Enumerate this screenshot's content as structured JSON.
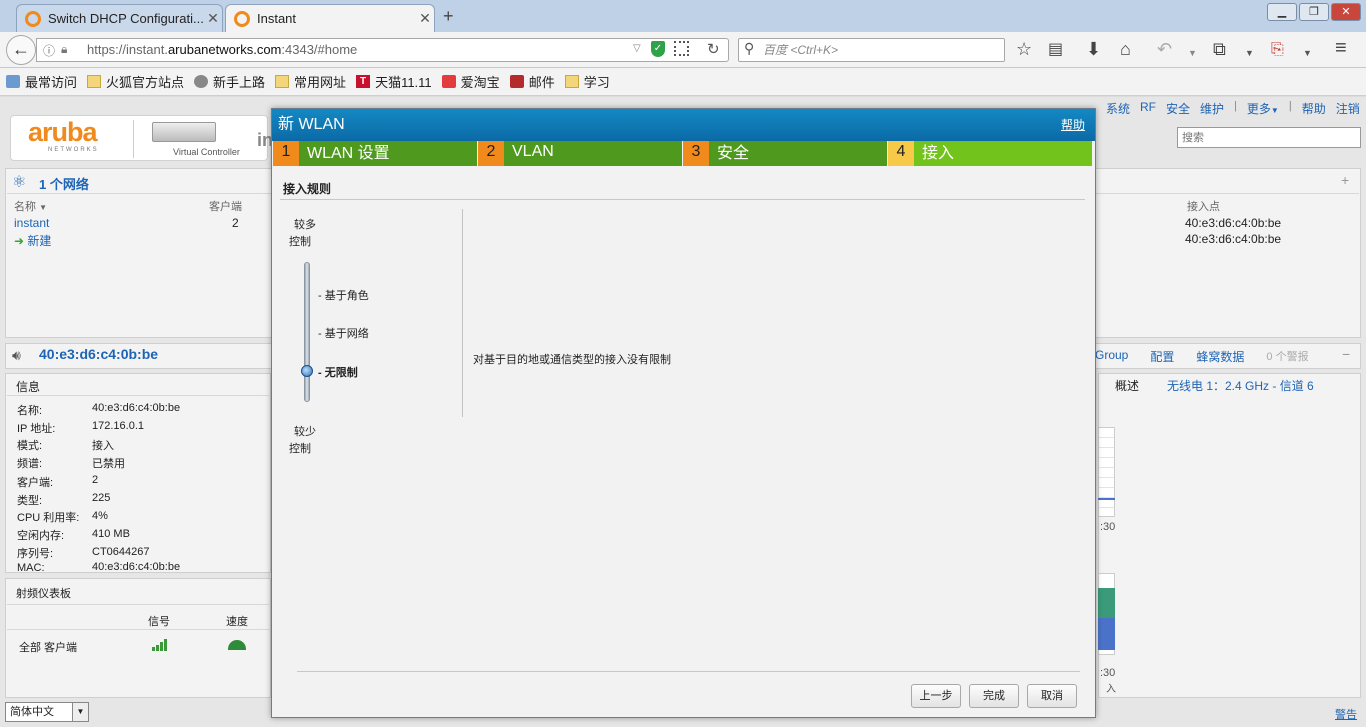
{
  "browser": {
    "tabs": [
      {
        "label": "Switch DHCP Configurati...",
        "active": false
      },
      {
        "label": "Instant",
        "active": true
      }
    ],
    "url_prefix": "https://instant.",
    "url_domain": "arubanetworks.com",
    "url_suffix": ":4343/#home",
    "search_placeholder": "百度 <Ctrl+K>",
    "bookmarks": [
      "最常访问",
      "火狐官方站点",
      "新手上路",
      "常用网址",
      "天猫11.11",
      "爱淘宝",
      "邮件",
      "学习"
    ]
  },
  "app": {
    "brand": "aruba",
    "brand_sub": "NETWORKS",
    "controller_label": "Virtual Controller",
    "top_links": [
      "系统",
      "RF",
      "安全",
      "维护",
      "更多",
      "帮助",
      "注销"
    ],
    "search_placeholder": "搜索",
    "networks_header": "1 个网络",
    "col_name": "名称",
    "col_clients": "客户端",
    "col_ap": "接入点",
    "network_name": "instant",
    "network_clients": "2",
    "new_label": "新建",
    "ap_values": [
      "40:e3:d6:c4:0b:be",
      "40:e3:d6:c4:0b:be"
    ],
    "device_header": "40:e3:d6:c4:0b:be",
    "right_links": [
      "Group",
      "配置",
      "蜂窝数据",
      "0 个警报"
    ],
    "overview_tab": "概述",
    "radio_tab": "无线电 1：2.4 GHz - 信道 6",
    "info_title": "信息",
    "info": [
      {
        "k": "名称:",
        "v": "40:e3:d6:c4:0b:be"
      },
      {
        "k": "IP 地址:",
        "v": "172.16.0.1"
      },
      {
        "k": "模式:",
        "v": "接入"
      },
      {
        "k": "频谱:",
        "v": "已禁用"
      },
      {
        "k": "客户端:",
        "v": "2"
      },
      {
        "k": "类型:",
        "v": "225"
      },
      {
        "k": "CPU 利用率:",
        "v": "4%"
      },
      {
        "k": "空闲内存:",
        "v": "410 MB"
      },
      {
        "k": "序列号:",
        "v": "CT0644267"
      },
      {
        "k": "MAC:",
        "v": "40:e3:d6:c4:0b:be"
      }
    ],
    "rf_title": "射频仪表板",
    "rf_signal": "信号",
    "rf_speed": "速度",
    "rf_row": "全部 客户端",
    "chart_time_1": ":30",
    "chart_time_2": ":30",
    "chart_label": "入",
    "language": "简体中文",
    "footer_link": "警告"
  },
  "modal": {
    "title": "新 WLAN",
    "help": "帮助",
    "steps": [
      {
        "num": "1",
        "label": "WLAN 设置"
      },
      {
        "num": "2",
        "label": "VLAN"
      },
      {
        "num": "3",
        "label": "安全"
      },
      {
        "num": "4",
        "label": "接入"
      }
    ],
    "section_title": "接入规则",
    "more_1": "较多",
    "more_2": "控制",
    "less_1": "较少",
    "less_2": "控制",
    "options": [
      "- 基于角色",
      "- 基于网络",
      "- 无限制"
    ],
    "selected_option": "- 无限制",
    "description": "对基于目的地或通信类型的接入没有限制",
    "btn_prev": "上一步",
    "btn_finish": "完成",
    "btn_cancel": "取消"
  }
}
